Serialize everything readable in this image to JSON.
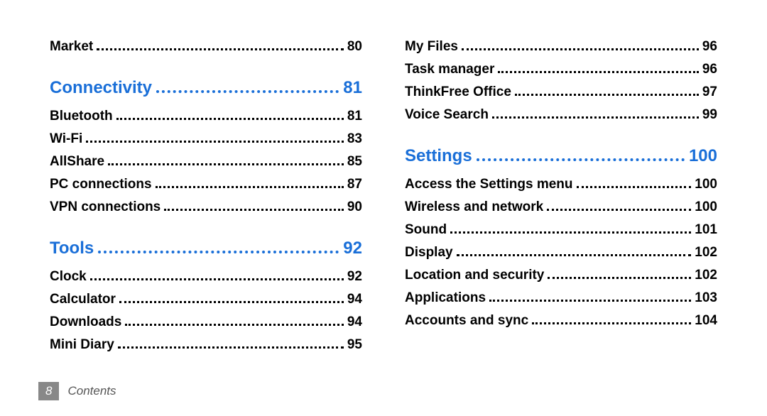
{
  "left_column": [
    {
      "kind": "entry",
      "label": "Market",
      "page": "80"
    },
    {
      "kind": "section",
      "label": "Connectivity",
      "page": "81"
    },
    {
      "kind": "entry",
      "label": "Bluetooth",
      "page": "81"
    },
    {
      "kind": "entry",
      "label": "Wi-Fi",
      "page": "83"
    },
    {
      "kind": "entry",
      "label": "AllShare",
      "page": "85"
    },
    {
      "kind": "entry",
      "label": "PC connections",
      "page": "87"
    },
    {
      "kind": "entry",
      "label": "VPN connections",
      "page": "90"
    },
    {
      "kind": "section",
      "label": "Tools",
      "page": "92"
    },
    {
      "kind": "entry",
      "label": "Clock",
      "page": "92"
    },
    {
      "kind": "entry",
      "label": "Calculator",
      "page": "94"
    },
    {
      "kind": "entry",
      "label": "Downloads",
      "page": "94"
    },
    {
      "kind": "entry",
      "label": "Mini Diary",
      "page": "95"
    }
  ],
  "right_column": [
    {
      "kind": "entry",
      "label": "My Files",
      "page": "96"
    },
    {
      "kind": "entry",
      "label": "Task manager",
      "page": "96"
    },
    {
      "kind": "entry",
      "label": "ThinkFree Office",
      "page": "97"
    },
    {
      "kind": "entry",
      "label": "Voice Search",
      "page": "99"
    },
    {
      "kind": "section",
      "label": "Settings",
      "page": "100"
    },
    {
      "kind": "entry",
      "label": "Access the Settings menu",
      "page": "100"
    },
    {
      "kind": "entry",
      "label": "Wireless and network",
      "page": "100"
    },
    {
      "kind": "entry",
      "label": "Sound",
      "page": "101"
    },
    {
      "kind": "entry",
      "label": "Display",
      "page": "102"
    },
    {
      "kind": "entry",
      "label": "Location and security",
      "page": "102"
    },
    {
      "kind": "entry",
      "label": "Applications",
      "page": "103"
    },
    {
      "kind": "entry",
      "label": "Accounts and sync",
      "page": "104"
    }
  ],
  "footer": {
    "page_number": "8",
    "label": "Contents"
  }
}
